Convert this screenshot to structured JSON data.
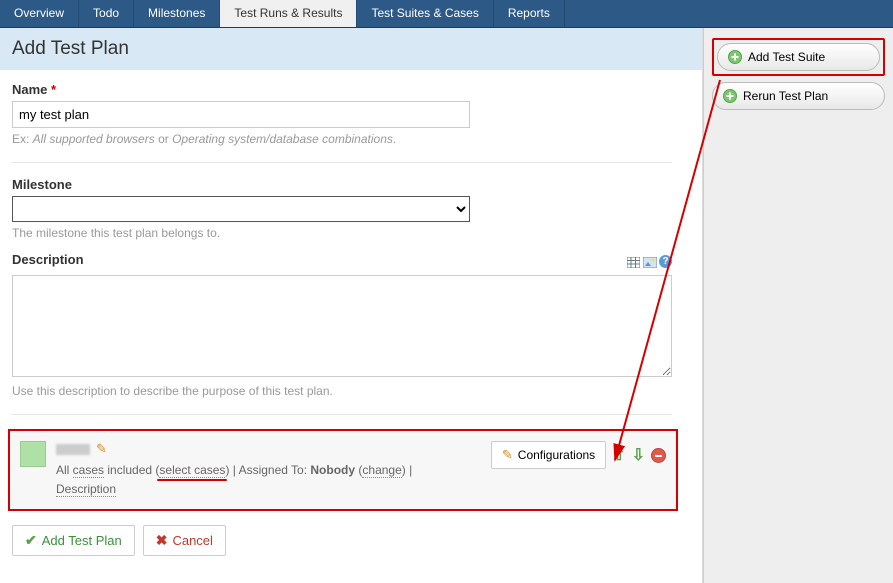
{
  "tabs": [
    {
      "label": "Overview",
      "active": false
    },
    {
      "label": "Todo",
      "active": false
    },
    {
      "label": "Milestones",
      "active": false
    },
    {
      "label": "Test Runs & Results",
      "active": true
    },
    {
      "label": "Test Suites & Cases",
      "active": false
    },
    {
      "label": "Reports",
      "active": false
    }
  ],
  "page_title": "Add Test Plan",
  "form": {
    "name_label": "Name",
    "name_value": "my test plan",
    "name_help_prefix": "Ex: ",
    "name_help_em1": "All supported browsers",
    "name_help_mid": " or ",
    "name_help_em2": "Operating system/database combinations",
    "name_help_suffix": ".",
    "milestone_label": "Milestone",
    "milestone_help": "The milestone this test plan belongs to.",
    "description_label": "Description",
    "description_help": "Use this description to describe the purpose of this test plan."
  },
  "suite": {
    "all_included": "All ",
    "cases_word": "cases",
    "included_word": " included (",
    "select_cases": "select cases",
    "close_paren": ")",
    "sep": " | ",
    "assigned_label": "Assigned To: ",
    "assigned_value": "Nobody",
    "change": "change",
    "description_link": "Description",
    "config_button": "Configurations"
  },
  "footer": {
    "add_label": "Add Test Plan",
    "cancel_label": "Cancel"
  },
  "sidebar": {
    "add_suite": "Add Test Suite",
    "rerun": "Rerun Test Plan"
  }
}
